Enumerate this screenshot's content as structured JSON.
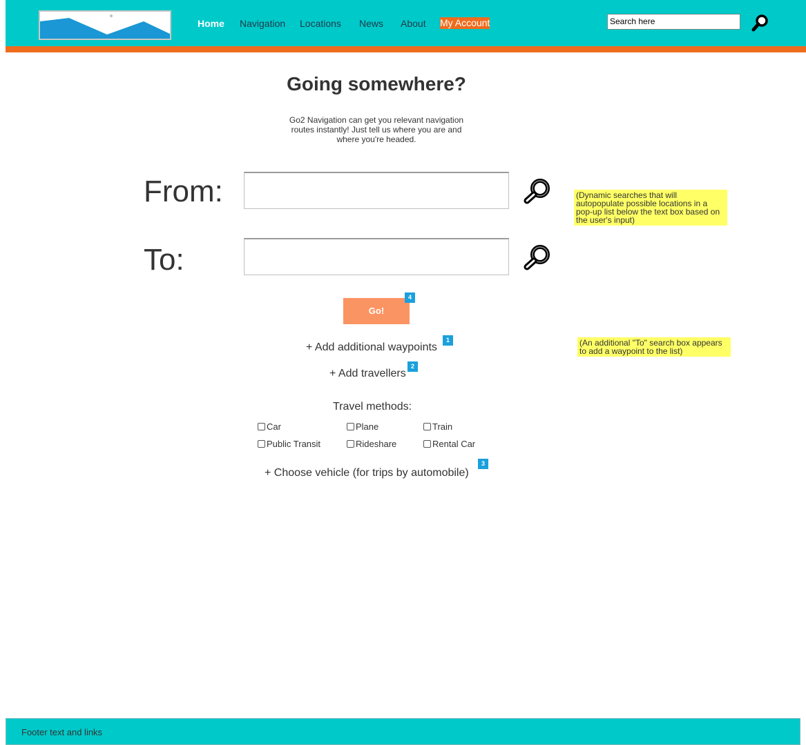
{
  "header": {
    "logo": "image-placeholder-logo",
    "nav": [
      {
        "label": "Home",
        "state": "active"
      },
      {
        "label": "Navigation"
      },
      {
        "label": "Locations"
      },
      {
        "label": "News"
      },
      {
        "label": "About"
      },
      {
        "label": "My Account",
        "highlight": "#ef6c1e"
      }
    ],
    "search_value": "Search here",
    "search_icon": "magnifier-icon"
  },
  "main": {
    "title": "Going somewhere?",
    "intro": "Go2 Navigation can get you relevant navigation routes instantly! Just tell us where you are and where you're headed.",
    "from_label": "From:",
    "to_label": "To:",
    "from_value": "",
    "to_value": "",
    "search_icon": "magnifier-icon",
    "note_dynamic": "(Dynamic searches that will autopopulate possible locations in a pop-up list below the text box based on the user's input)",
    "go_label": "Go!",
    "add_waypoints": "+ Add additional waypoints",
    "note_waypoint": "(An additional \"To\" search box appears to add a waypoint to the list)",
    "add_travellers": "+ Add travellers",
    "travel_methods_title": "Travel methods:",
    "travel_methods": [
      "Car",
      "Plane",
      "Train",
      "Public Transit",
      "Rideshare",
      "Rental Car"
    ],
    "choose_vehicle": "+ Choose vehicle (for trips by automobile)",
    "badges": [
      "1",
      "2",
      "3",
      "4"
    ]
  },
  "footer": {
    "text": "Footer text and links"
  },
  "colors": {
    "header_bg": "#00c9c9",
    "accent_bar": "#ef6c1e",
    "go_button": "#fb9463",
    "note_bg": "#ffff66",
    "badge": "#1aa0dd"
  }
}
